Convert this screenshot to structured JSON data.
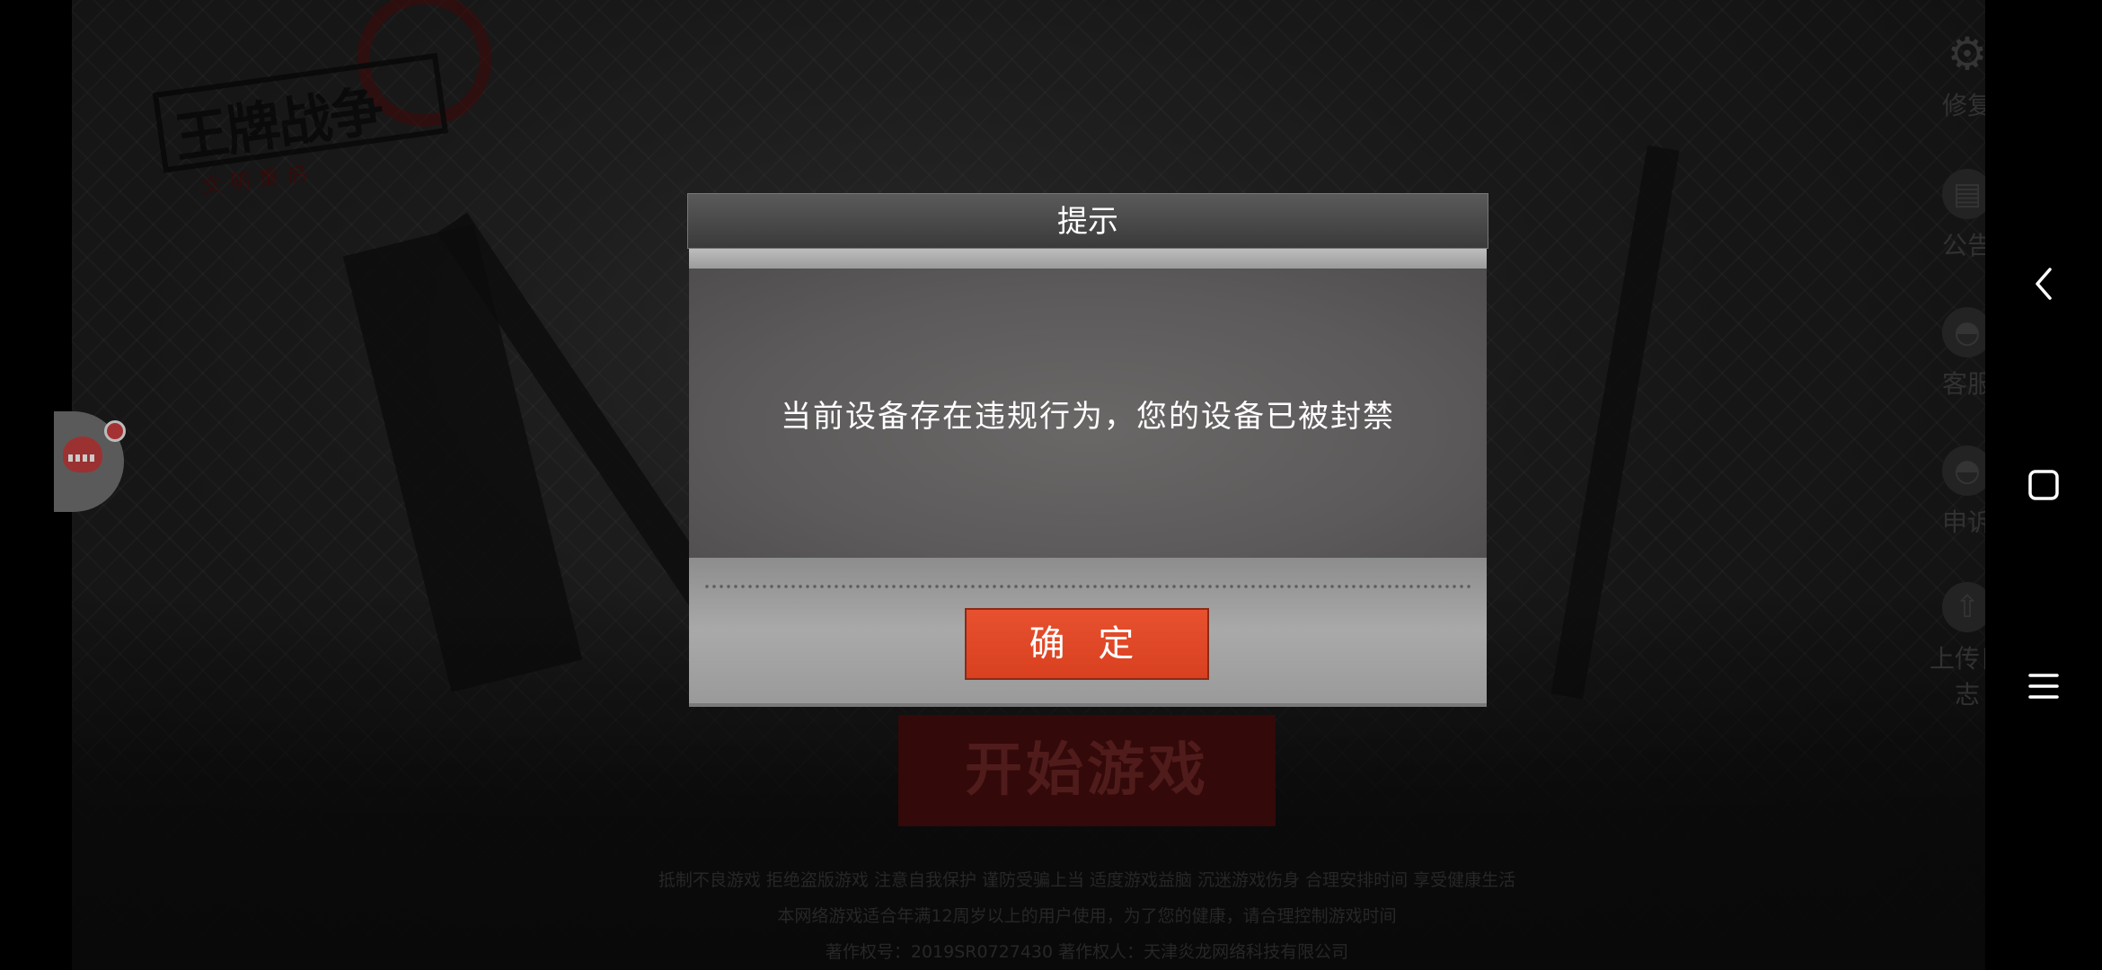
{
  "game": {
    "logo_title": "王牌战争",
    "logo_subtitle": "文明重启",
    "start_button_label": "开始游戏",
    "footer_lines": [
      "抵制不良游戏 拒绝盗版游戏 注意自我保护 谨防受骗上当 适度游戏益脑 沉迷游戏伤身 合理安排时间 享受健康生活",
      "本网络游戏适合年满12周岁以上的用户使用，为了您的健康，请合理控制游戏时间",
      "著作权号：2019SR0727430       著作权人：天津炎龙网络科技有限公司"
    ]
  },
  "tools": [
    {
      "key": "repair",
      "label": "修复",
      "icon": "gear-icon"
    },
    {
      "key": "notice",
      "label": "公告",
      "icon": "notice-icon"
    },
    {
      "key": "service",
      "label": "客服",
      "icon": "headset-icon"
    },
    {
      "key": "appeal",
      "label": "申诉",
      "icon": "headset-icon"
    },
    {
      "key": "upload",
      "label": "上传日志",
      "icon": "upload-icon"
    }
  ],
  "dialog": {
    "title": "提示",
    "message": "当前设备存在违规行为，您的设备已被封禁",
    "confirm_label": "确 定"
  },
  "nav": {
    "back_icon": "chevron-left-icon",
    "home_icon": "square-icon",
    "menu_icon": "menu-icon"
  },
  "colors": {
    "confirm_button": "#e04a28",
    "dialog_header": "#4a4a4a",
    "dialog_body": "#5f5d5d"
  }
}
